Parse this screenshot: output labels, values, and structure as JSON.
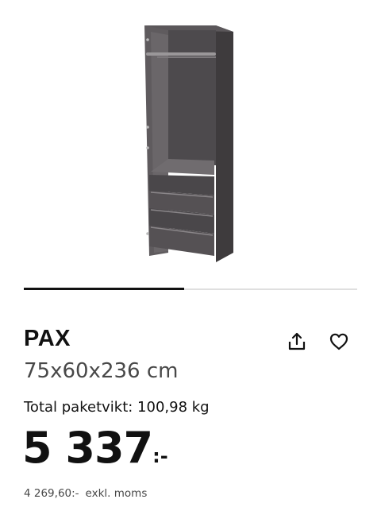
{
  "product": {
    "image_icon": "wardrobe-image",
    "name": "PAX",
    "dimensions": "75x60x236 cm",
    "package_weight": "Total paketvikt: 100,98 kg",
    "price": {
      "amount": "5 337",
      "suffix": ":-"
    },
    "price_ex_vat": {
      "amount": "4 269,60:-",
      "label": "exkl. moms"
    }
  },
  "gallery": {
    "progress_fraction": 0.48
  },
  "actions": {
    "share_icon": "share-icon",
    "favorite_icon": "heart-icon"
  },
  "colors": {
    "progress": "#111111",
    "track": "#dfdfdf",
    "wardrobe": "#545053"
  }
}
